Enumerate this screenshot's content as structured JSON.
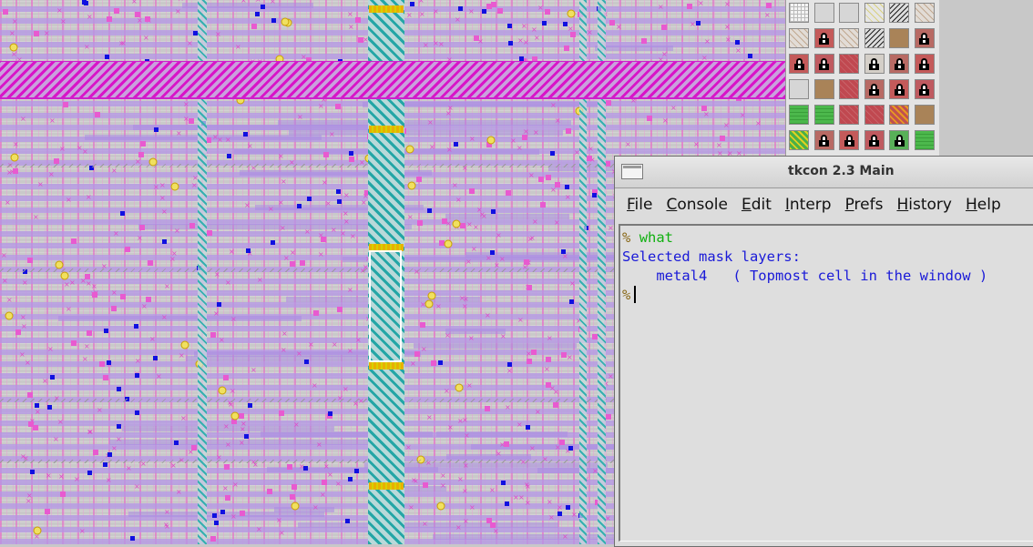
{
  "tkcon": {
    "title": "tkcon 2.3 Main",
    "menu": [
      "File",
      "Console",
      "Edit",
      "Interp",
      "Prefs",
      "History",
      "Help"
    ],
    "console": {
      "prompt": "%",
      "command": "what",
      "output_line1": "Selected mask layers:",
      "output_line2": "    metal4   ( Topmost cell in the window )"
    }
  },
  "palette": {
    "rows": [
      [
        "grid",
        "plain",
        "plain",
        "yellow-hatch",
        "black-hatch",
        "tan-hatch"
      ],
      [
        "tan-hatch",
        "lock",
        "tan-hatch",
        "black-hatch",
        "brown",
        "lock"
      ],
      [
        "lock",
        "lock",
        "red",
        "lock",
        "lock",
        "lock"
      ],
      [
        "plain",
        "brown",
        "red",
        "lock",
        "lock",
        "lock"
      ],
      [
        "green",
        "green",
        "red",
        "red",
        "orange-hatch",
        "brown"
      ],
      [
        "green-hatch",
        "lock",
        "lock",
        "lock",
        "lock",
        "green"
      ]
    ]
  },
  "colors": {
    "canvas_bg": "#c9c9c9",
    "metal_strap": "#d815c8",
    "teal_strap": "#24a6a6",
    "via": "#e8b000",
    "console_output": "#1a1ad8",
    "console_command": "#10b010"
  }
}
